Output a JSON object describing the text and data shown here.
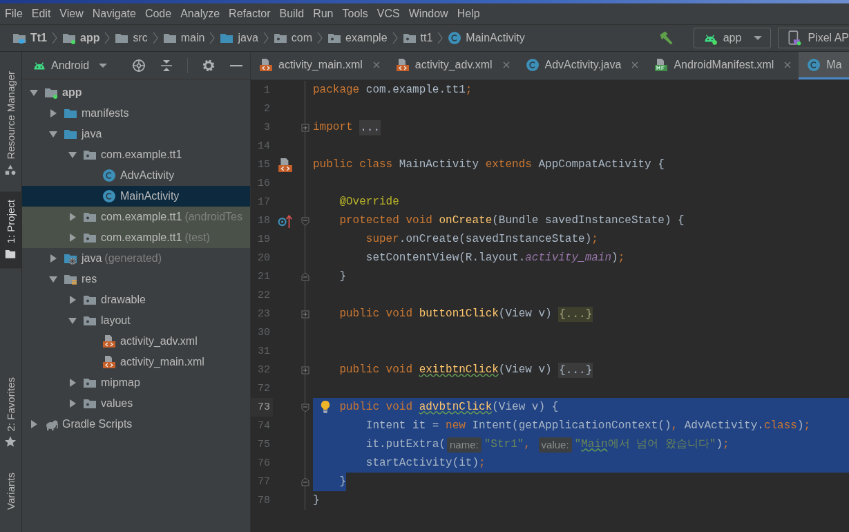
{
  "menu": [
    "File",
    "Edit",
    "View",
    "Navigate",
    "Code",
    "Analyze",
    "Refactor",
    "Build",
    "Run",
    "Tools",
    "VCS",
    "Window",
    "Help"
  ],
  "breadcrumbs": [
    {
      "label": "Tt1",
      "kind": "project"
    },
    {
      "label": "app",
      "kind": "module"
    },
    {
      "label": "src",
      "kind": "folder"
    },
    {
      "label": "main",
      "kind": "folder"
    },
    {
      "label": "java",
      "kind": "source-folder"
    },
    {
      "label": "com",
      "kind": "package"
    },
    {
      "label": "example",
      "kind": "package"
    },
    {
      "label": "tt1",
      "kind": "package"
    },
    {
      "label": "MainActivity",
      "kind": "class"
    }
  ],
  "run_toolbar": {
    "configuration": "app",
    "device": "Pixel AP"
  },
  "tool_windows": [
    {
      "label": "Resource Manager",
      "kind": "resources",
      "selected": false
    },
    {
      "label": "1: Project",
      "kind": "folder",
      "selected": true
    },
    {
      "label": "2: Favorites",
      "kind": "star",
      "selected": false
    },
    {
      "label": "Variants",
      "kind": "plain",
      "selected": false
    }
  ],
  "project_panel": {
    "view": "Android",
    "tree": [
      {
        "label": "app",
        "kind": "module",
        "expanded": true,
        "selected": false,
        "highlighted": false,
        "children": [
          {
            "label": "manifests",
            "kind": "source-folder",
            "expanded": false,
            "selected": false,
            "highlighted": false
          },
          {
            "label": "java",
            "kind": "source-folder",
            "expanded": true,
            "selected": false,
            "highlighted": false,
            "children": [
              {
                "label": "com.example.tt1",
                "kind": "package",
                "expanded": true,
                "selected": false,
                "highlighted": false,
                "children": [
                  {
                    "label": "AdvActivity",
                    "kind": "class",
                    "selected": false,
                    "highlighted": false
                  },
                  {
                    "label": "MainActivity",
                    "kind": "class",
                    "selected": true,
                    "highlighted": false
                  }
                ]
              },
              {
                "label": "com.example.tt1",
                "note": "(androidTes",
                "kind": "package",
                "expanded": false,
                "selected": false,
                "highlighted": true
              },
              {
                "label": "com.example.tt1",
                "note": "(test)",
                "kind": "package",
                "expanded": false,
                "selected": false,
                "highlighted": true
              }
            ]
          },
          {
            "label": "java",
            "note": "(generated)",
            "kind": "generated-folder",
            "expanded": false,
            "selected": false,
            "highlighted": false
          },
          {
            "label": "res",
            "kind": "res-folder",
            "expanded": true,
            "selected": false,
            "highlighted": false,
            "children": [
              {
                "label": "drawable",
                "kind": "package",
                "expanded": false,
                "selected": false,
                "highlighted": false
              },
              {
                "label": "layout",
                "kind": "package",
                "expanded": true,
                "selected": false,
                "highlighted": false,
                "children": [
                  {
                    "label": "activity_adv.xml",
                    "kind": "xml",
                    "selected": false,
                    "highlighted": false
                  },
                  {
                    "label": "activity_main.xml",
                    "kind": "xml",
                    "selected": false,
                    "highlighted": false
                  }
                ]
              },
              {
                "label": "mipmap",
                "kind": "package",
                "expanded": false,
                "selected": false,
                "highlighted": false
              },
              {
                "label": "values",
                "kind": "package",
                "expanded": false,
                "selected": false,
                "highlighted": false
              }
            ]
          }
        ]
      },
      {
        "label": "Gradle Scripts",
        "kind": "gradle",
        "expanded": false,
        "selected": false,
        "highlighted": false
      }
    ]
  },
  "editor": {
    "tabs": [
      {
        "label": "activity_main.xml",
        "kind": "xml",
        "selected": false,
        "closable": true
      },
      {
        "label": "activity_adv.xml",
        "kind": "xml",
        "selected": false,
        "closable": true
      },
      {
        "label": "AdvActivity.java",
        "kind": "class",
        "selected": false,
        "closable": true
      },
      {
        "label": "AndroidManifest.xml",
        "kind": "manifest",
        "selected": false,
        "closable": true
      },
      {
        "label": "Ma",
        "kind": "class",
        "selected": true,
        "closable": false
      }
    ],
    "lines": [
      {
        "number": "1",
        "kind": "code",
        "folded": false,
        "fold_open": false,
        "fold_close": false,
        "selected": false,
        "current": false,
        "tokens": [
          {
            "kind": "keyword",
            "text": "package "
          },
          {
            "kind": "plain",
            "text": "com.example.tt1"
          },
          {
            "kind": "keyword",
            "text": ";"
          }
        ]
      },
      {
        "number": "2",
        "kind": "code",
        "folded": false,
        "fold_open": false,
        "fold_close": false,
        "selected": false,
        "current": false
      },
      {
        "number": "3",
        "kind": "code",
        "folded": true,
        "fold_open": false,
        "fold_close": false,
        "selected": false,
        "current": false,
        "tokens": [
          {
            "kind": "keyword",
            "text": "import "
          },
          {
            "kind": "fold",
            "text": "..."
          }
        ]
      },
      {
        "number": "14",
        "kind": "code",
        "folded": false,
        "fold_open": false,
        "fold_close": false,
        "selected": false,
        "current": false
      },
      {
        "number": "15",
        "kind": "layout-link",
        "folded": false,
        "fold_open": false,
        "fold_close": false,
        "selected": false,
        "current": false,
        "tokens": [
          {
            "kind": "keyword",
            "text": "public class "
          },
          {
            "kind": "plain",
            "text": "MainActivity "
          },
          {
            "kind": "keyword",
            "text": "extends "
          },
          {
            "kind": "plain",
            "text": "AppCompatActivity {"
          }
        ]
      },
      {
        "number": "16",
        "kind": "code",
        "folded": false,
        "fold_open": false,
        "fold_close": false,
        "selected": false,
        "current": false
      },
      {
        "number": "17",
        "kind": "code",
        "folded": false,
        "fold_open": false,
        "fold_close": false,
        "selected": false,
        "current": false,
        "tokens": [
          {
            "kind": "annotation",
            "text": "    @Override"
          }
        ]
      },
      {
        "number": "18",
        "kind": "override",
        "folded": false,
        "fold_open": true,
        "fold_close": false,
        "selected": false,
        "current": false,
        "tokens": [
          {
            "kind": "keyword",
            "text": "    protected void "
          },
          {
            "kind": "method",
            "text": "onCreate"
          },
          {
            "kind": "plain",
            "text": "(Bundle savedInstanceState) {"
          }
        ]
      },
      {
        "number": "19",
        "kind": "code",
        "folded": false,
        "fold_open": false,
        "fold_close": false,
        "selected": false,
        "current": false,
        "tokens": [
          {
            "kind": "keyword",
            "text": "        super"
          },
          {
            "kind": "plain",
            "text": ".onCreate(savedInstanceState)"
          },
          {
            "kind": "keyword",
            "text": ";"
          }
        ]
      },
      {
        "number": "20",
        "kind": "code",
        "folded": false,
        "fold_open": false,
        "fold_close": false,
        "selected": false,
        "current": false,
        "tokens": [
          {
            "kind": "plain",
            "text": "        setContentView(R.layout."
          },
          {
            "kind": "field",
            "text": "activity_main"
          },
          {
            "kind": "plain",
            "text": ")"
          },
          {
            "kind": "keyword",
            "text": ";"
          }
        ]
      },
      {
        "number": "21",
        "kind": "code",
        "folded": false,
        "fold_open": false,
        "fold_close": true,
        "selected": false,
        "current": false,
        "tokens": [
          {
            "kind": "plain",
            "text": "    }"
          }
        ]
      },
      {
        "number": "22",
        "kind": "code",
        "folded": false,
        "fold_open": false,
        "fold_close": false,
        "selected": false,
        "current": false
      },
      {
        "number": "23",
        "kind": "code",
        "folded": true,
        "fold_open": false,
        "fold_close": false,
        "selected": false,
        "current": false,
        "tokens": [
          {
            "kind": "keyword",
            "text": "    public void "
          },
          {
            "kind": "method",
            "text": "button1Click"
          },
          {
            "kind": "plain",
            "text": "(View v) "
          },
          {
            "kind": "fold-match",
            "text": "{...}"
          }
        ]
      },
      {
        "number": "30",
        "kind": "code",
        "folded": false,
        "fold_open": false,
        "fold_close": false,
        "selected": false,
        "current": false
      },
      {
        "number": "31",
        "kind": "code",
        "folded": false,
        "fold_open": false,
        "fold_close": false,
        "selected": false,
        "current": false
      },
      {
        "number": "32",
        "kind": "code",
        "folded": true,
        "fold_open": false,
        "fold_close": false,
        "selected": false,
        "current": false,
        "tokens": [
          {
            "kind": "keyword",
            "text": "    public void "
          },
          {
            "kind": "method-typo",
            "text": "exitbtnClick"
          },
          {
            "kind": "plain",
            "text": "(View v) "
          },
          {
            "kind": "fold",
            "text": "{...}"
          }
        ]
      },
      {
        "number": "72",
        "kind": "code",
        "folded": false,
        "fold_open": false,
        "fold_close": false,
        "selected": false,
        "current": false
      },
      {
        "number": "73",
        "kind": "intention",
        "folded": false,
        "fold_open": true,
        "fold_close": false,
        "selected": true,
        "selected_to_end": true,
        "current": true,
        "tokens": [
          {
            "kind": "keyword",
            "text": "    public void "
          },
          {
            "kind": "method-typo",
            "text": "advbtnClick"
          },
          {
            "kind": "plain",
            "text": "(View v) {"
          }
        ]
      },
      {
        "number": "74",
        "kind": "code",
        "folded": false,
        "fold_open": false,
        "fold_close": false,
        "selected": true,
        "selected_to_end": true,
        "current": false,
        "tokens": [
          {
            "kind": "plain",
            "text": "        Intent it = "
          },
          {
            "kind": "keyword",
            "text": "new "
          },
          {
            "kind": "plain",
            "text": "Intent(getApplicationContext()"
          },
          {
            "kind": "keyword",
            "text": ", "
          },
          {
            "kind": "plain",
            "text": "AdvActivity."
          },
          {
            "kind": "keyword",
            "text": "class"
          },
          {
            "kind": "plain",
            "text": ")"
          },
          {
            "kind": "keyword",
            "text": ";"
          }
        ]
      },
      {
        "number": "75",
        "kind": "code",
        "folded": false,
        "fold_open": false,
        "fold_close": false,
        "selected": true,
        "selected_to_end": true,
        "current": false,
        "tokens": [
          {
            "kind": "plain",
            "text": "        it.putExtra("
          },
          {
            "kind": "hint",
            "text": "name:"
          },
          {
            "kind": "string",
            "text": "\"Str1\""
          },
          {
            "kind": "keyword",
            "text": ", "
          },
          {
            "kind": "hint",
            "text": "value:"
          },
          {
            "kind": "string",
            "text": "\""
          },
          {
            "kind": "string-typo",
            "text": "Main"
          },
          {
            "kind": "string",
            "text": "에서 넘어 왔습니다\""
          },
          {
            "kind": "plain",
            "text": ")"
          },
          {
            "kind": "keyword",
            "text": ";"
          }
        ]
      },
      {
        "number": "76",
        "kind": "code",
        "folded": false,
        "fold_open": false,
        "fold_close": false,
        "selected": true,
        "selected_to_end": true,
        "current": false,
        "tokens": [
          {
            "kind": "plain",
            "text": "        startActivity(it)"
          },
          {
            "kind": "keyword",
            "text": ";"
          }
        ]
      },
      {
        "number": "77",
        "kind": "code",
        "folded": false,
        "fold_open": false,
        "fold_close": true,
        "selected": true,
        "selected_to_end": false,
        "current": false,
        "tokens": [
          {
            "kind": "plain",
            "text": "    }"
          }
        ]
      },
      {
        "number": "78",
        "kind": "code",
        "folded": false,
        "fold_open": false,
        "fold_close": false,
        "selected": false,
        "current": false,
        "tokens": [
          {
            "kind": "plain",
            "text": "}"
          }
        ]
      }
    ]
  }
}
